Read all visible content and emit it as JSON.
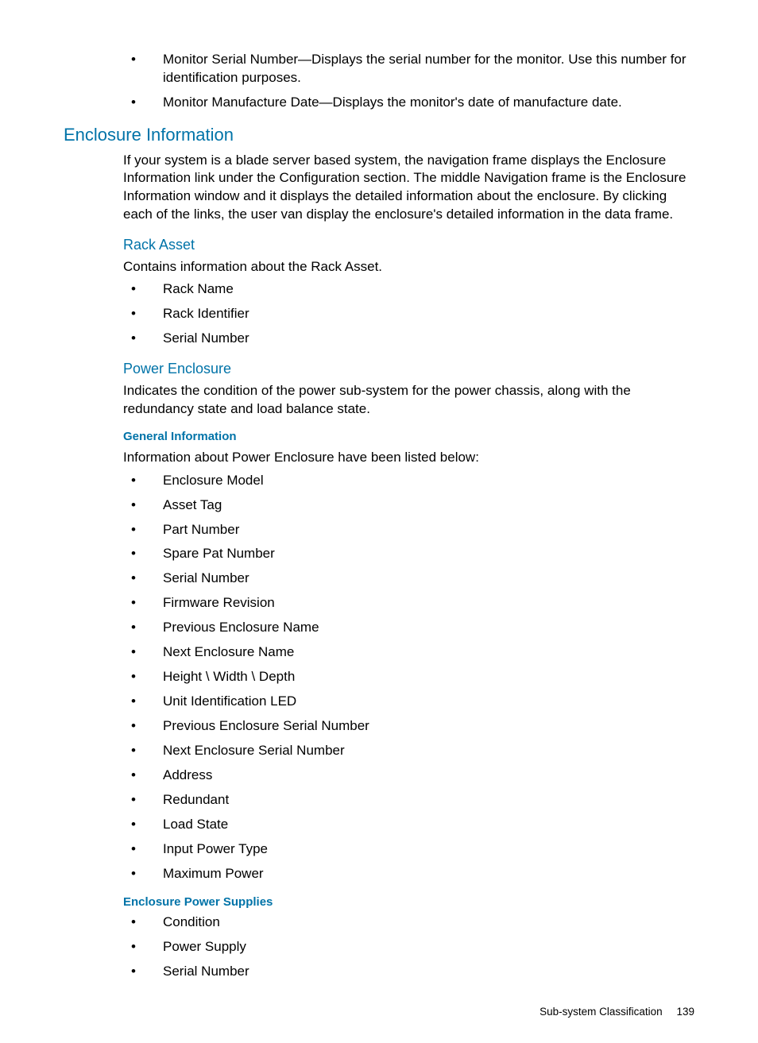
{
  "intro_bullets": [
    "Monitor Serial Number—Displays the serial number for the monitor. Use this number for identification purposes.",
    "Monitor Manufacture Date—Displays the monitor's date of manufacture date."
  ],
  "enclosure": {
    "heading": "Enclosure Information",
    "para": "If your system is a blade server based system, the navigation frame displays the Enclosure Information link under the Configuration section. The middle Navigation frame is the Enclosure Information window and it displays the detailed information about the enclosure. By clicking each of the links, the user van display the enclosure's detailed information in the data frame."
  },
  "rack_asset": {
    "heading": "Rack Asset",
    "para": "Contains information about the Rack Asset.",
    "items": [
      "Rack Name",
      "Rack Identifier",
      "Serial Number"
    ]
  },
  "power_enclosure": {
    "heading": "Power Enclosure",
    "para": "Indicates the condition of the power sub-system for the power chassis, along with the redundancy state and load balance state."
  },
  "general_info": {
    "heading": "General Information",
    "para": "Information about Power Enclosure have been listed below:",
    "items": [
      "Enclosure Model",
      "Asset Tag",
      "Part Number",
      "Spare Pat Number",
      "Serial Number",
      "Firmware Revision",
      "Previous Enclosure Name",
      "Next Enclosure Name",
      "Height \\ Width \\ Depth",
      "Unit Identification LED",
      "Previous Enclosure Serial Number",
      "Next Enclosure Serial Number",
      "Address",
      "Redundant",
      "Load State",
      "Input Power Type",
      "Maximum Power"
    ]
  },
  "eps": {
    "heading": "Enclosure Power Supplies",
    "items": [
      "Condition",
      "Power Supply",
      "Serial Number"
    ]
  },
  "footer": {
    "section": "Sub-system Classification",
    "page": "139"
  }
}
